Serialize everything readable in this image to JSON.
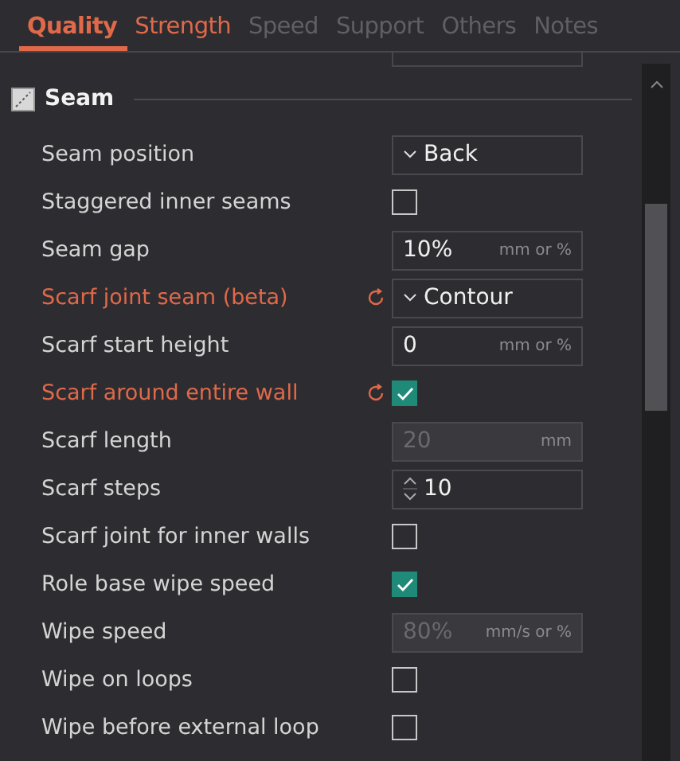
{
  "tabs": [
    {
      "label": "Quality",
      "selected": true,
      "modified": true
    },
    {
      "label": "Strength",
      "selected": false,
      "modified": true
    },
    {
      "label": "Speed",
      "selected": false,
      "modified": false
    },
    {
      "label": "Support",
      "selected": false,
      "modified": false
    },
    {
      "label": "Others",
      "selected": false,
      "modified": false
    },
    {
      "label": "Notes",
      "selected": false,
      "modified": false
    }
  ],
  "section": {
    "title": "Seam"
  },
  "options": [
    {
      "label": "Seam position",
      "kind": "combo",
      "value": "Back",
      "modified": false
    },
    {
      "label": "Staggered inner seams",
      "kind": "checkbox",
      "checked": false,
      "modified": false
    },
    {
      "label": "Seam gap",
      "kind": "input",
      "value": "10%",
      "unit": "mm or %",
      "disabled": false,
      "modified": false
    },
    {
      "label": "Scarf joint seam (beta)",
      "kind": "combo",
      "value": "Contour",
      "modified": true
    },
    {
      "label": "Scarf start height",
      "kind": "input",
      "value": "0",
      "unit": "mm or %",
      "disabled": false,
      "modified": false
    },
    {
      "label": "Scarf around entire wall",
      "kind": "checkbox",
      "checked": true,
      "modified": true
    },
    {
      "label": "Scarf length",
      "kind": "input",
      "value": "20",
      "unit": "mm",
      "disabled": true,
      "modified": false
    },
    {
      "label": "Scarf steps",
      "kind": "spin",
      "value": "10",
      "modified": false
    },
    {
      "label": "Scarf joint for inner walls",
      "kind": "checkbox",
      "checked": false,
      "modified": false
    },
    {
      "label": "Role base wipe speed",
      "kind": "checkbox",
      "checked": true,
      "modified": false
    },
    {
      "label": "Wipe speed",
      "kind": "input",
      "value": "80%",
      "unit": "mm/s or %",
      "disabled": true,
      "modified": false
    },
    {
      "label": "Wipe on loops",
      "kind": "checkbox",
      "checked": false,
      "modified": false
    },
    {
      "label": "Wipe before external loop",
      "kind": "checkbox",
      "checked": false,
      "modified": false
    }
  ]
}
